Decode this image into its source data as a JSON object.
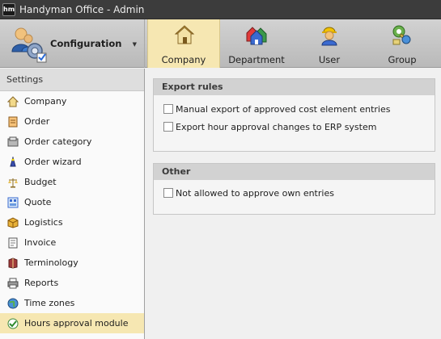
{
  "window": {
    "logo_text": "hm",
    "title": "Handyman Office - Admin"
  },
  "header": {
    "config_label": "Configuration",
    "tabs": [
      {
        "label": "Company",
        "icon": "house-icon",
        "active": true
      },
      {
        "label": "Department",
        "icon": "department-houses-icon",
        "active": false
      },
      {
        "label": "User",
        "icon": "worker-helmet-icon",
        "active": false
      },
      {
        "label": "Group",
        "icon": "group-keys-icon",
        "active": false
      }
    ]
  },
  "sidebar": {
    "header": "Settings",
    "items": [
      {
        "label": "Company",
        "icon": "house-icon"
      },
      {
        "label": "Order",
        "icon": "order-icon"
      },
      {
        "label": "Order category",
        "icon": "order-category-icon"
      },
      {
        "label": "Order wizard",
        "icon": "wizard-icon"
      },
      {
        "label": "Budget",
        "icon": "scale-icon"
      },
      {
        "label": "Quote",
        "icon": "quote-icon"
      },
      {
        "label": "Logistics",
        "icon": "box-icon"
      },
      {
        "label": "Invoice",
        "icon": "invoice-icon"
      },
      {
        "label": "Terminology",
        "icon": "book-icon"
      },
      {
        "label": "Reports",
        "icon": "printer-icon"
      },
      {
        "label": "Time zones",
        "icon": "globe-icon"
      },
      {
        "label": "Hours approval module",
        "icon": "check-badge-icon",
        "active": true
      }
    ]
  },
  "main": {
    "export_rules": {
      "title": "Export rules",
      "options": [
        {
          "label": "Manual export of approved cost element entries",
          "checked": false
        },
        {
          "label": "Export hour approval changes to ERP system",
          "checked": false
        }
      ]
    },
    "other": {
      "title": "Other",
      "options": [
        {
          "label": "Not allowed to approve own entries",
          "checked": false
        }
      ]
    }
  }
}
